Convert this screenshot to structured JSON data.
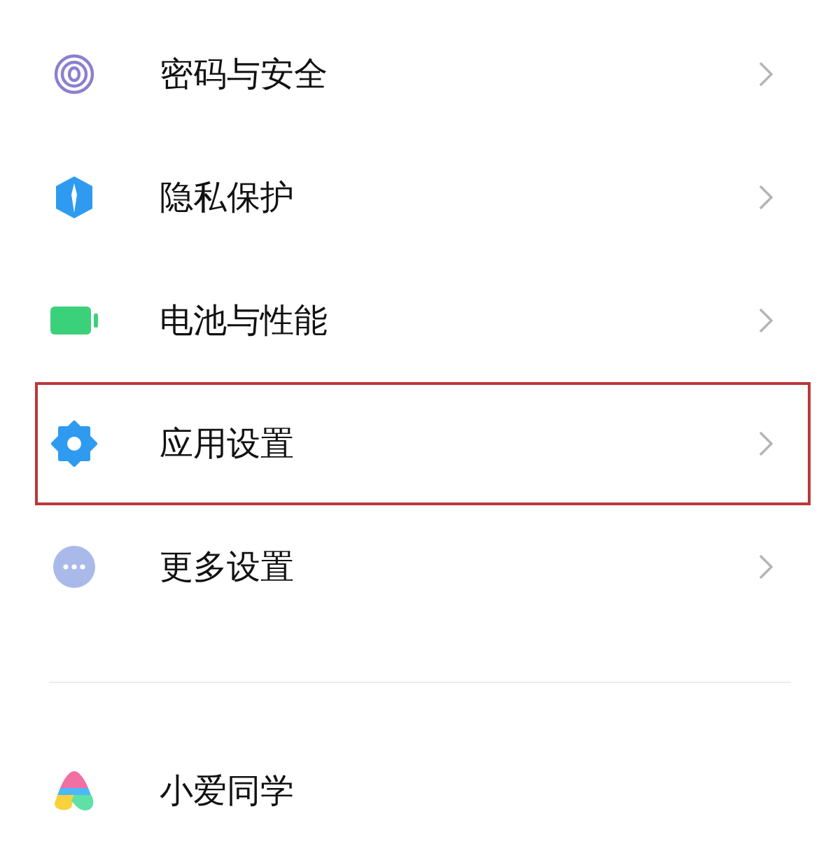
{
  "sections": [
    {
      "items": [
        {
          "kind": "fingerprint",
          "label": "密码与安全",
          "chevron": true,
          "highlighted": false
        },
        {
          "kind": "shield",
          "label": "隐私保护",
          "chevron": true,
          "highlighted": false
        },
        {
          "kind": "battery",
          "label": "电池与性能",
          "chevron": true,
          "highlighted": false
        },
        {
          "kind": "gear",
          "label": "应用设置",
          "chevron": true,
          "highlighted": true
        },
        {
          "kind": "dots",
          "label": "更多设置",
          "chevron": true,
          "highlighted": false
        }
      ]
    },
    {
      "items": [
        {
          "kind": "assistant",
          "label": "小爱同学",
          "chevron": false,
          "highlighted": false
        }
      ]
    }
  ]
}
